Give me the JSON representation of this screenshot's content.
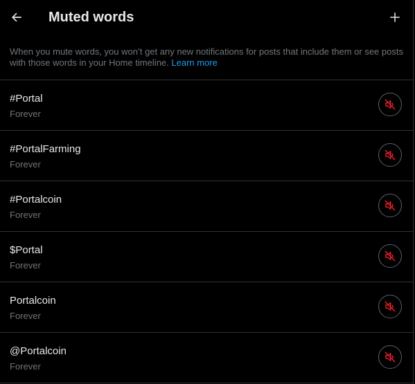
{
  "header": {
    "title": "Muted words",
    "back_icon": "arrow-left-icon",
    "add_icon": "plus-icon"
  },
  "description": {
    "text": "When you mute words, you won’t get any new notifications for posts that include them or see posts with those words in your Home timeline.",
    "link_label": "Learn more"
  },
  "muted_words": [
    {
      "word": "#Portal",
      "duration": "Forever"
    },
    {
      "word": "#PortalFarming",
      "duration": "Forever"
    },
    {
      "word": "#Portalcoin",
      "duration": "Forever"
    },
    {
      "word": "$Portal",
      "duration": "Forever"
    },
    {
      "word": "Portalcoin",
      "duration": "Forever"
    },
    {
      "word": "@Portalcoin",
      "duration": "Forever"
    }
  ],
  "unmute_icon": "speaker-muted-icon",
  "colors": {
    "background": "#000000",
    "text_primary": "#e7e9ea",
    "text_secondary": "#71767b",
    "link": "#1d9bf0",
    "divider": "#2f3336",
    "unmute_accent": "#f4212e"
  }
}
